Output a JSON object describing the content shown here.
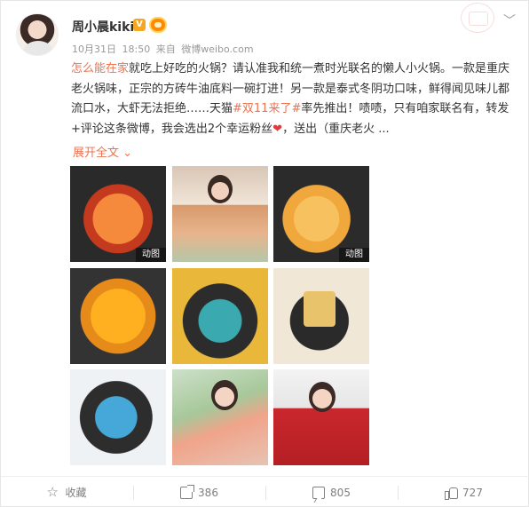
{
  "user": {
    "name": "周小晨kiki",
    "verified_icon": "verified-v-badge",
    "vip_icon": "vip-badge"
  },
  "meta": {
    "date": "10月31日",
    "time": "18:50",
    "from_label": "来自",
    "source": "微博weibo.com"
  },
  "post": {
    "highlight_phrase": "怎么能在家",
    "text_1": "就吃上好吃的火锅？请认准我和统一煮时光联名的懒人小火锅。一款是重庆老火锅味，正宗的方砖牛油底料一碗打进！另一款是泰式冬阴功口味，鲜得闻见味儿都流口水，大虾无法拒绝……天猫",
    "hashtag": "#双11来了#",
    "text_2": "率先推出！啧啧，只有咱家联名有，转发+评论这条微博，我会选出2个幸运粉丝",
    "heart": "❤",
    "text_3": "，送出（重庆老火 ...",
    "expand_label": "展开全文",
    "expand_icon": "chevron-down-icon"
  },
  "images": [
    {
      "name": "image-hotpot-chongqing",
      "badge": "动图"
    },
    {
      "name": "image-woman-eating",
      "badge": ""
    },
    {
      "name": "image-hotpot-tomyum",
      "badge": "动图"
    },
    {
      "name": "image-shrimp-soup",
      "badge": ""
    },
    {
      "name": "image-package-teal",
      "badge": ""
    },
    {
      "name": "image-package-black",
      "badge": ""
    },
    {
      "name": "image-package-blue",
      "badge": ""
    },
    {
      "name": "image-woman-holding-box",
      "badge": ""
    },
    {
      "name": "image-woman-red-dress",
      "badge": ""
    }
  ],
  "footer": {
    "favorite_label": "收藏",
    "repost_count": "386",
    "comment_count": "805",
    "like_count": "727"
  },
  "colors": {
    "accent": "#eb7350",
    "text": "#333333",
    "muted": "#999999"
  }
}
